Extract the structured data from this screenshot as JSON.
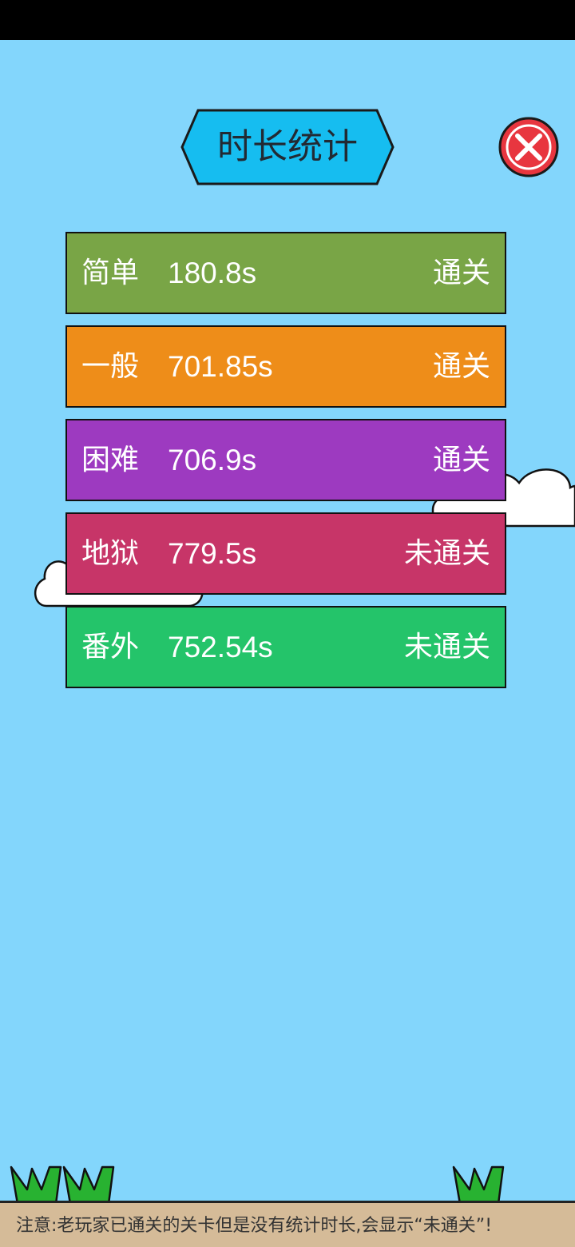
{
  "title": "时长统计",
  "close_icon": "close-x-icon",
  "rows": [
    {
      "name": "简单",
      "time": "180.8s",
      "status": "通关",
      "color": "#79a546"
    },
    {
      "name": "一般",
      "time": "701.85s",
      "status": "通关",
      "color": "#ee8d19"
    },
    {
      "name": "困难",
      "time": "706.9s",
      "status": "通关",
      "color": "#9d3ac0"
    },
    {
      "name": "地狱",
      "time": "779.5s",
      "status": "未通关",
      "color": "#c73568"
    },
    {
      "name": "番外",
      "time": "752.54s",
      "status": "未通关",
      "color": "#24c46a"
    }
  ],
  "notice": "注意:老玩家已通关的关卡但是没有统计时长,会显示“未通关”!",
  "colors": {
    "sky": "#83d6fc",
    "title_banner": "#16bdf0",
    "close_button": "#e8363f",
    "ground": "#d5bb98",
    "grass": "#28b231"
  }
}
